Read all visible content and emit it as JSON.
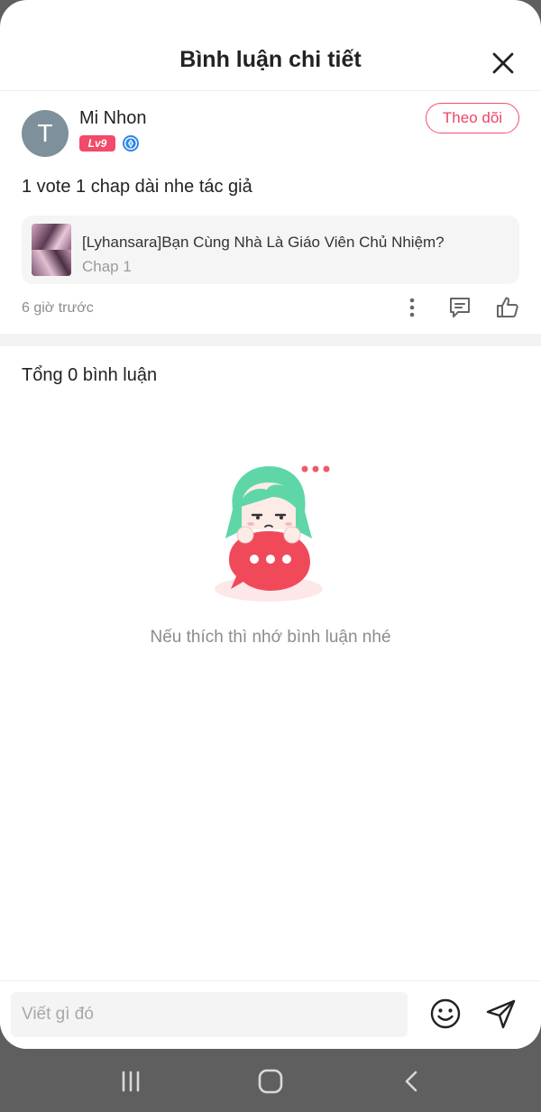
{
  "header": {
    "title": "Bình luận chi tiết",
    "close_icon": "close-icon"
  },
  "comment": {
    "avatar_letter": "T",
    "username": "Mi Nhon",
    "level": "Lv9",
    "rank_icon": "diamond-rank-icon",
    "follow_label": "Theo dõi",
    "text": "1 vote 1 chap dài nhe tác giả",
    "story": {
      "title": "[Lyhansara]Bạn Cùng Nhà Là Giáo Viên Chủ Nhiệm?",
      "chapter": "Chap 1"
    },
    "time": "6 giờ trước",
    "actions": [
      "more-icon",
      "reply-icon",
      "like-icon"
    ]
  },
  "replies": {
    "total_label": "Tổng 0 bình luận",
    "empty_message": "Nếu thích thì nhớ bình luận nhé"
  },
  "input": {
    "placeholder": "Viết gì đó",
    "emoji_icon": "emoji-icon",
    "send_icon": "send-icon"
  },
  "navbar": {
    "items": [
      "recent-apps-icon",
      "home-icon",
      "back-icon"
    ]
  },
  "colors": {
    "accent": "#f0506e",
    "avatar_bg": "#7d909b",
    "mascot_hair": "#5fd6a8",
    "mascot_bubble": "#f04a5a"
  }
}
